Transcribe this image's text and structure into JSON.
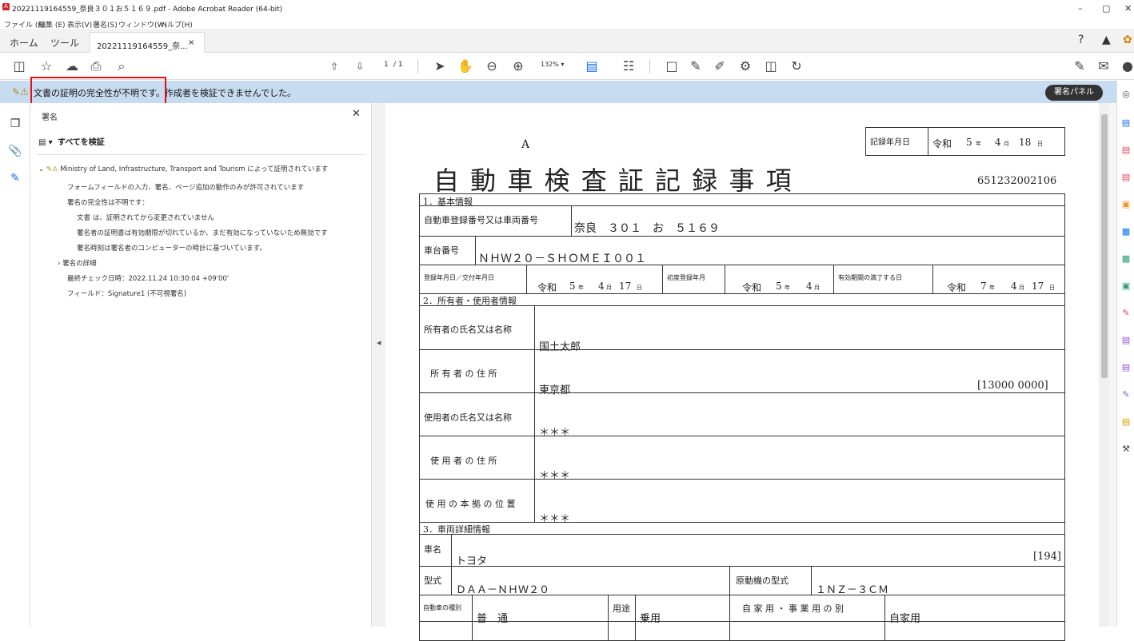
{
  "window": {
    "title": "20221119164559_奈良３０１お５１６９.pdf - Adobe Acrobat Reader (64-bit)",
    "app_icon": "A",
    "minimize": "–",
    "maximize": "▢",
    "close": "✕"
  },
  "menu": [
    "ファイル (F)",
    "編集 (E)",
    "表示(V)",
    "署名(S)",
    "ウィンドウ(W)",
    "ヘルプ(H)"
  ],
  "tabs": {
    "home": "ホーム",
    "tools": "ツール",
    "document": "20221119164559_奈...",
    "close": "×"
  },
  "toolbar": {
    "page_current": "1",
    "page_total": "/ 1",
    "zoom": "132%",
    "zoom_caret": "▾"
  },
  "signature_bar": {
    "message": "文書の証明の完全性が不明です。作成者を検証できませんでした。",
    "panel_button": "署名パネル"
  },
  "sig_panel": {
    "header": "署名",
    "verify_all": "すべてを検証",
    "certified_by": "Ministry of Land, Infrastructure, Transport and Tourism によって証明されています",
    "lines": [
      "フォームフィールドの入力、署名、ページ追加の動作のみが許可されています",
      "署名の完全性は不明です：",
      "文書 は、証明されてから変更されていません",
      "署名者の証明書は有効期限が切れているか、まだ有効になっていないため無効です",
      "署名時刻は署名者のコンピューターの時計に基づいています。",
      "署名の詳細",
      "最終チェック日時：2022.11.24 10:30:04 +09'00'",
      "フィールド：Signature1 (不可視署名)"
    ]
  },
  "document": {
    "corner_letter": "A",
    "record_date_label": "記録年月日",
    "record_date_era": "令和",
    "record_date_y": "5",
    "record_date_m": "4",
    "record_date_d": "18",
    "unit_y": "年",
    "unit_m": "月",
    "unit_d": "日",
    "title": "自 動 車 検 査 証 記 録 事 項",
    "doc_number": "651232002106",
    "sec1": "1．基本情報",
    "reg_label": "自動車登録番号又は車両番号",
    "reg_value": "奈良　３０１　お　５１６９",
    "chassis_label": "車台番号",
    "chassis_value": "ＮＨＷ２０－ＳＨＯＭＥＩ００１",
    "reg_date_label": "登録年月日／交付年月日",
    "reg_date_era": "令和",
    "reg_date_y": "5",
    "reg_date_m": "4",
    "reg_date_d": "17",
    "first_reg_label": "初度登録年月",
    "first_reg_era": "令和",
    "first_reg_y": "5",
    "first_reg_m": "4",
    "expiry_label": "有効期間の満了する日",
    "expiry_era": "令和",
    "expiry_y": "7",
    "expiry_m": "4",
    "expiry_d": "17",
    "sec2": "2．所有者・使用者情報",
    "owner_name_label": "所有者の氏名又は名称",
    "owner_name_value": "国土太郎",
    "owner_addr_label": "所 有 者 の 住 所",
    "owner_addr_value": "東京都",
    "owner_addr_code": "[13000 0000]",
    "user_name_label": "使用者の氏名又は名称",
    "user_name_value": "＊＊＊",
    "user_addr_label": "使 用 者 の 住 所",
    "user_addr_value": "＊＊＊",
    "base_label": "使 用 の 本 拠 の 位 置",
    "base_value": "＊＊＊",
    "sec3": "3．車両詳細情報",
    "car_name_label": "車名",
    "car_name_value": "トヨタ",
    "car_name_code": "[194]",
    "model_label": "型式",
    "model_value": "ＤＡＡ－ＮＨＷ２０",
    "engine_label": "原動機の型式",
    "engine_value": "１ＮＺ－３ＣＭ",
    "kind_label": "自動車の種別",
    "kind_value": "普　通",
    "use_label": "用途",
    "use_value": "乗用",
    "private_label": "自 家 用 ・ 事 業 用 の 別",
    "private_value": "自家用"
  }
}
